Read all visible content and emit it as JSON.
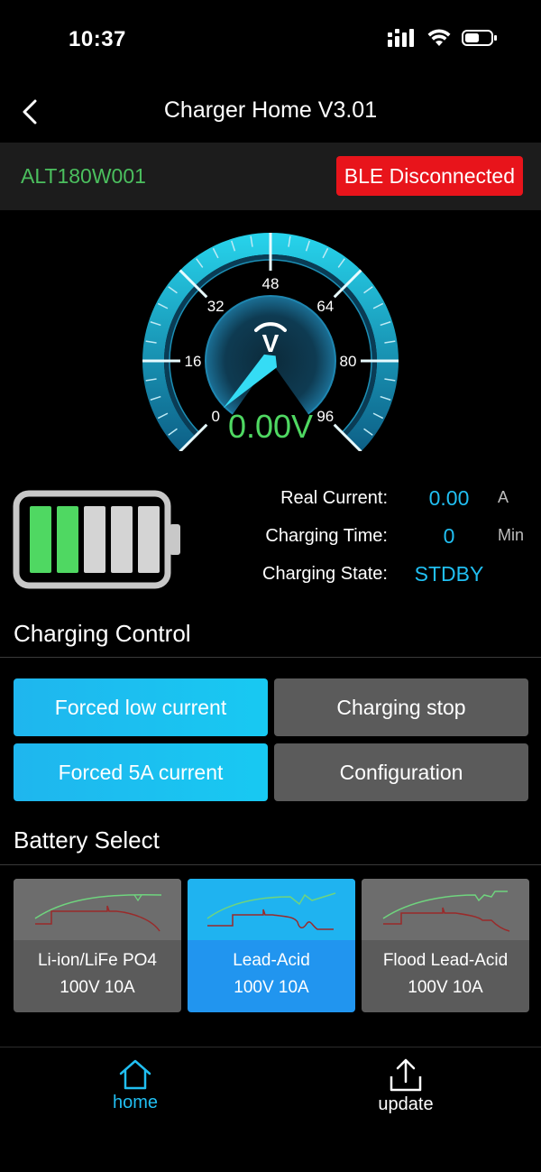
{
  "status_bar": {
    "time": "10:37"
  },
  "nav": {
    "title": "Charger Home V3.01"
  },
  "device": {
    "id": "ALT180W001",
    "ble_status": "BLE Disconnected"
  },
  "gauge": {
    "ticks": [
      "0",
      "16",
      "32",
      "48",
      "64",
      "80",
      "96"
    ],
    "unit_symbol": "V",
    "value": "0.00V",
    "reading": 0,
    "max": 96
  },
  "battery_indicator": {
    "filled_bars": 2,
    "total_bars": 5
  },
  "readouts": {
    "real_current": {
      "label": "Real Current:",
      "value": "0.00",
      "unit": "A"
    },
    "charging_time": {
      "label": "Charging Time:",
      "value": "0",
      "unit": "Min"
    },
    "charging_state": {
      "label": "Charging State:",
      "value": "STDBY"
    }
  },
  "charging_control": {
    "title": "Charging Control",
    "buttons": [
      {
        "label": "Forced low current",
        "active": true
      },
      {
        "label": "Charging stop",
        "active": false
      },
      {
        "label": "Forced 5A current",
        "active": true
      },
      {
        "label": "Configuration",
        "active": false
      }
    ]
  },
  "battery_select": {
    "title": "Battery Select",
    "options": [
      {
        "name": "Li-ion/LiFe PO4",
        "spec": "100V 10A",
        "selected": false
      },
      {
        "name": "Lead-Acid",
        "spec": "100V 10A",
        "selected": true
      },
      {
        "name": "Flood Lead-Acid",
        "spec": "100V 10A",
        "selected": false
      }
    ]
  },
  "tabs": [
    {
      "label": "home",
      "active": true
    },
    {
      "label": "update",
      "active": false
    }
  ],
  "colors": {
    "accent": "#21bff2",
    "voltage": "#4fd862",
    "device_id": "#4bbf5e",
    "alert": "#e8141b",
    "selected_card": "#2195ef"
  }
}
